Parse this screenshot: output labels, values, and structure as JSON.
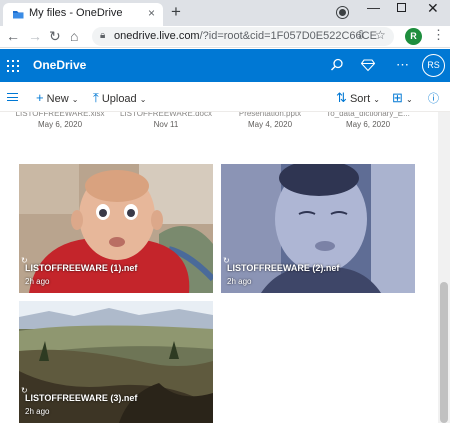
{
  "browser": {
    "tab_title": "My files - OneDrive",
    "tab_close": "×",
    "new_tab": "+",
    "url_host": "onedrive.live.com",
    "url_path": "/?id=root&cid=1F057D0E522C66CE",
    "profile_initial": "R"
  },
  "app": {
    "name": "OneDrive",
    "avatar_initials": "RS",
    "accent": "#0078d4"
  },
  "commands": {
    "new_label": "New",
    "upload_label": "Upload",
    "sort_label": "Sort"
  },
  "previous_row": [
    {
      "name": "LISTOFFREEWARE.xlsx",
      "date": "May 6, 2020"
    },
    {
      "name": "LISTOFFREEWARE.docx",
      "date": "Nov 11"
    },
    {
      "name": "Presentation.pptx",
      "date": "May 4, 2020"
    },
    {
      "name": "To_data_dictionary_E...",
      "date": "May 6, 2020"
    }
  ],
  "files": [
    {
      "name": "LISTOFFREEWARE (1).nef",
      "modified": "2h ago"
    },
    {
      "name": "LISTOFFREEWARE (2).nef",
      "modified": "2h ago"
    },
    {
      "name": "LISTOFFREEWARE (3).nef",
      "modified": "2h ago"
    }
  ]
}
